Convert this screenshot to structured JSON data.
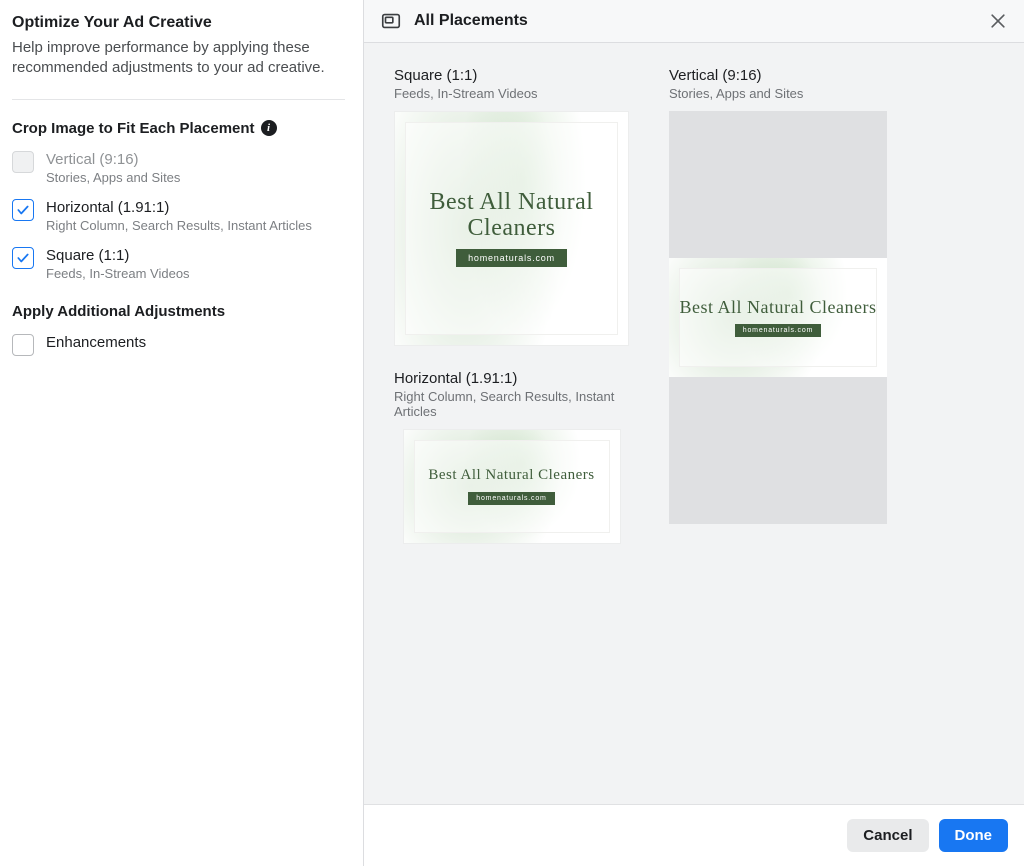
{
  "sidebar": {
    "title": "Optimize Your Ad Creative",
    "description": "Help improve performance by applying these recommended adjustments to your ad creative.",
    "crop_section_title": "Crop Image to Fit Each Placement",
    "options": [
      {
        "title": "Vertical (9:16)",
        "subtitle": "Stories, Apps and Sites",
        "checked": false,
        "disabled": true
      },
      {
        "title": "Horizontal (1.91:1)",
        "subtitle": "Right Column, Search Results, Instant Articles",
        "checked": true,
        "disabled": false
      },
      {
        "title": "Square (1:1)",
        "subtitle": "Feeds, In-Stream Videos",
        "checked": true,
        "disabled": false
      }
    ],
    "adjustments_section_title": "Apply Additional Adjustments",
    "adjustments": [
      {
        "title": "Enhancements",
        "checked": false
      }
    ]
  },
  "main": {
    "header_title": "All Placements",
    "previews": {
      "square": {
        "title": "Square (1:1)",
        "subtitle": "Feeds, In-Stream Videos"
      },
      "vertical": {
        "title": "Vertical (9:16)",
        "subtitle": "Stories, Apps and Sites"
      },
      "horizontal": {
        "title": "Horizontal (1.91:1)",
        "subtitle": "Right Column, Search Results, Instant Articles"
      }
    },
    "ad_creative": {
      "headline": "Best All Natural Cleaners",
      "url_label": "homenaturals.com"
    },
    "buttons": {
      "cancel": "Cancel",
      "done": "Done"
    }
  }
}
